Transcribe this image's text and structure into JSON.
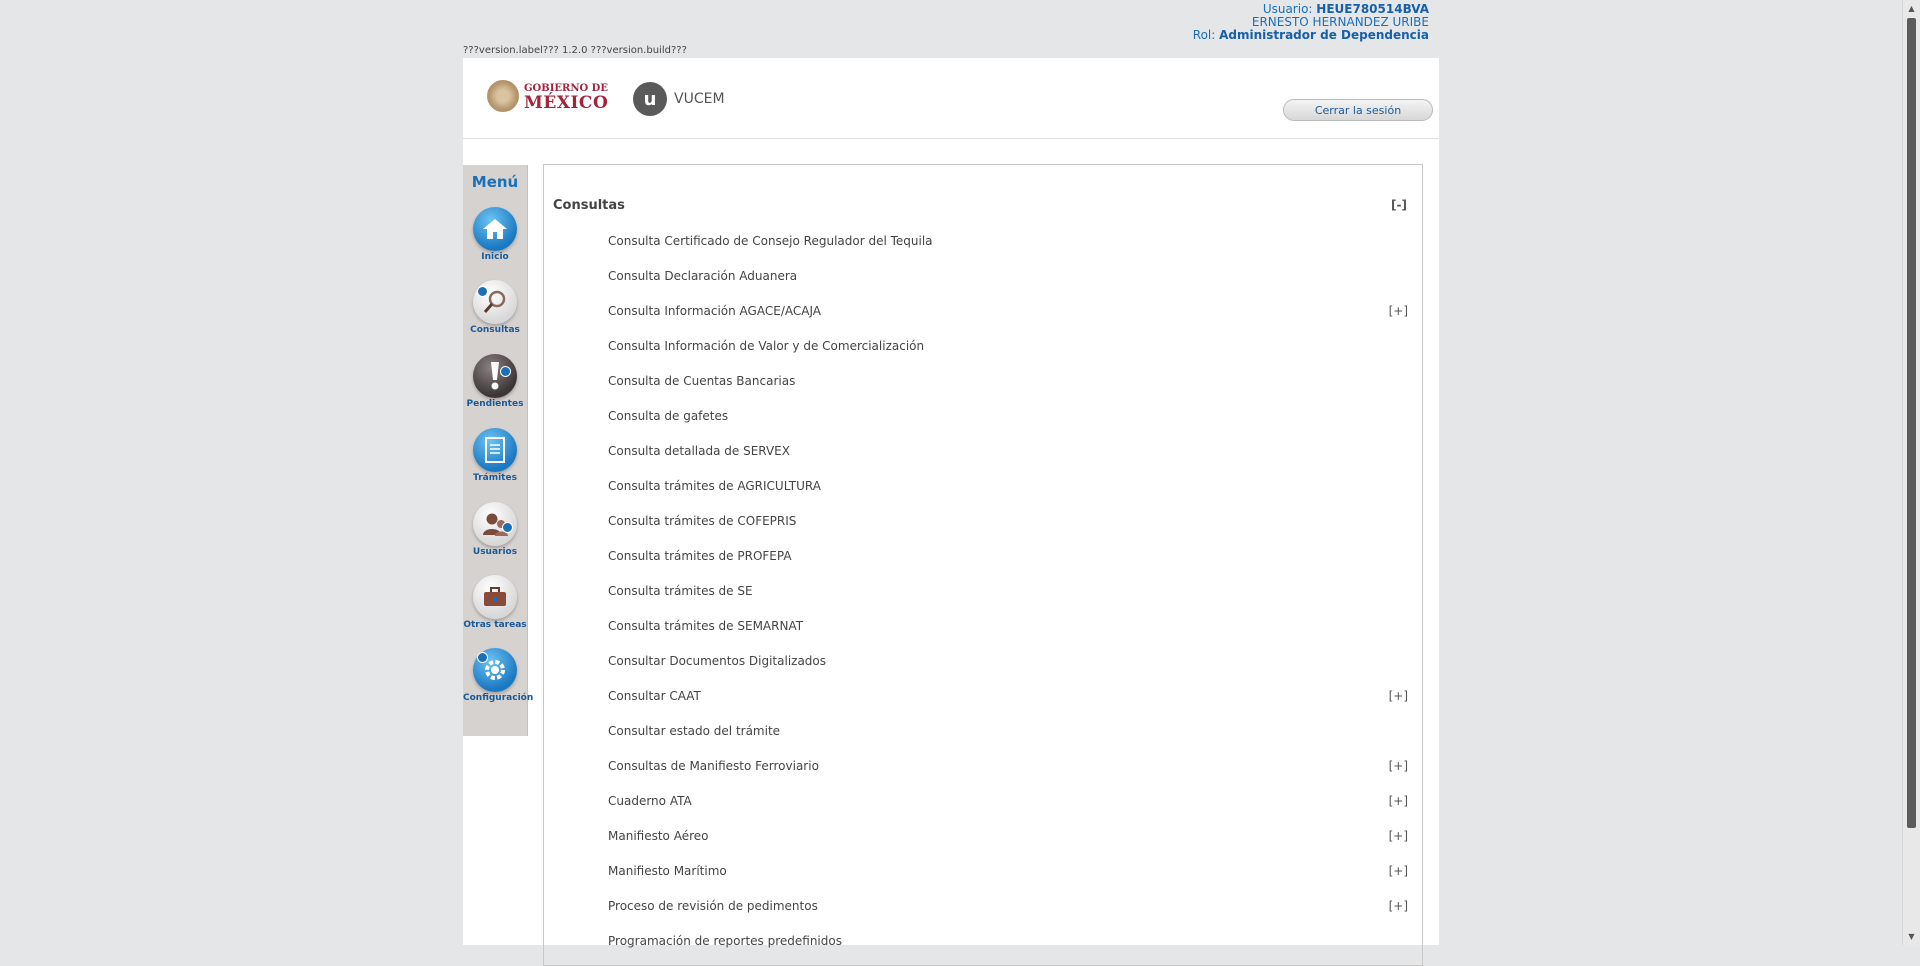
{
  "user_info": {
    "usuario_label": "Usuario:",
    "usuario_value": "HEUE780514BVA",
    "name": "ERNESTO HERNANDEZ URIBE",
    "rol_label": "Rol:",
    "rol_value": "Administrador de Dependencia"
  },
  "version_text": "???version.label??? 1.2.0 ???version.build???",
  "header": {
    "gob_line1": "GOBIERNO DE",
    "gob_line2": "MÉXICO",
    "vucem_letter": "u",
    "vucem_text": "VUCEM",
    "logout_label": "Cerrar la sesión"
  },
  "menu": {
    "title": "Menú",
    "items": [
      {
        "label": "Inicio",
        "icon": "home-icon"
      },
      {
        "label": "Consultas",
        "icon": "magnifier-icon"
      },
      {
        "label": "Pendientes",
        "icon": "exclamation-icon"
      },
      {
        "label": "Trámites",
        "icon": "document-icon"
      },
      {
        "label": "Usuarios",
        "icon": "users-icon"
      },
      {
        "label": "Otras tareas",
        "icon": "briefcase-icon"
      },
      {
        "label": "Configuración",
        "icon": "gear-icon"
      }
    ]
  },
  "consultas": {
    "title": "Consultas",
    "toggle": "[-]",
    "items": [
      {
        "label": "Consulta Certificado de Consejo Regulador del Tequila",
        "expand": ""
      },
      {
        "label": "Consulta Declaración Aduanera",
        "expand": ""
      },
      {
        "label": "Consulta Información AGACE/ACAJA",
        "expand": "[+]"
      },
      {
        "label": "Consulta Información de Valor y de Comercialización",
        "expand": ""
      },
      {
        "label": "Consulta de Cuentas Bancarias",
        "expand": ""
      },
      {
        "label": "Consulta de gafetes",
        "expand": ""
      },
      {
        "label": "Consulta detallada de SERVEX",
        "expand": ""
      },
      {
        "label": "Consulta trámites de AGRICULTURA",
        "expand": ""
      },
      {
        "label": "Consulta trámites de COFEPRIS",
        "expand": ""
      },
      {
        "label": "Consulta trámites de PROFEPA",
        "expand": ""
      },
      {
        "label": "Consulta trámites de SE",
        "expand": ""
      },
      {
        "label": "Consulta trámites de SEMARNAT",
        "expand": ""
      },
      {
        "label": "Consultar Documentos Digitalizados",
        "expand": ""
      },
      {
        "label": "Consultar CAAT",
        "expand": "[+]"
      },
      {
        "label": "Consultar estado del trámite",
        "expand": ""
      },
      {
        "label": "Consultas de Manifiesto Ferroviario",
        "expand": "[+]"
      },
      {
        "label": "Cuaderno ATA",
        "expand": "[+]"
      },
      {
        "label": "Manifiesto Aéreo",
        "expand": "[+]"
      },
      {
        "label": "Manifiesto Marítimo",
        "expand": "[+]"
      },
      {
        "label": "Proceso de revisión de pedimentos",
        "expand": "[+]"
      },
      {
        "label": "Programación de reportes predefinidos",
        "expand": ""
      }
    ]
  },
  "colors": {
    "accent": "#1a6fb8",
    "brand": "#a2243c",
    "background": "#e5e6e8"
  }
}
